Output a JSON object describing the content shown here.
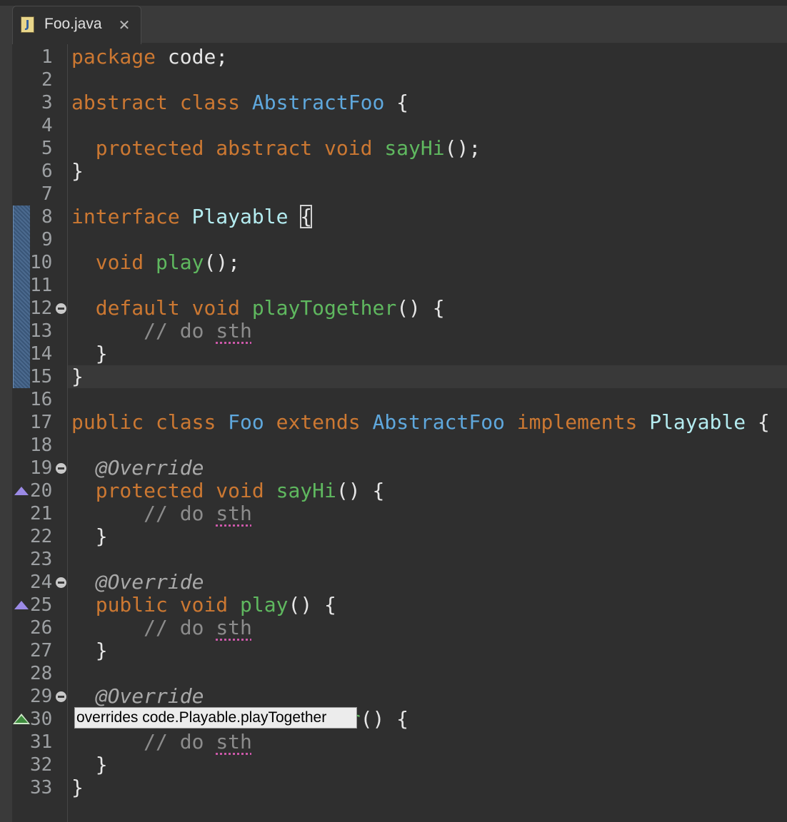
{
  "tab": {
    "title": "Foo.java",
    "icon": "java-file-icon",
    "close_icon": "close-icon"
  },
  "tooltip": "overrides code.Playable.playTogether",
  "lines": [
    {
      "n": "1",
      "tokens": [
        [
          "kw",
          "package"
        ],
        [
          "txt",
          " code;"
        ]
      ]
    },
    {
      "n": "2",
      "tokens": []
    },
    {
      "n": "3",
      "tokens": [
        [
          "kw",
          "abstract"
        ],
        [
          "txt",
          " "
        ],
        [
          "kw",
          "class"
        ],
        [
          "txt",
          " "
        ],
        [
          "cls",
          "AbstractFoo"
        ],
        [
          "txt",
          " {"
        ]
      ]
    },
    {
      "n": "4",
      "tokens": []
    },
    {
      "n": "5",
      "tokens": [
        [
          "txt",
          "  "
        ],
        [
          "kw",
          "protected"
        ],
        [
          "txt",
          " "
        ],
        [
          "kw",
          "abstract"
        ],
        [
          "txt",
          " "
        ],
        [
          "kw",
          "void"
        ],
        [
          "txt",
          " "
        ],
        [
          "mth",
          "sayHi"
        ],
        [
          "txt",
          "();"
        ]
      ]
    },
    {
      "n": "6",
      "tokens": [
        [
          "txt",
          "}"
        ]
      ]
    },
    {
      "n": "7",
      "tokens": []
    },
    {
      "n": "8",
      "tokens": [
        [
          "kw",
          "interface"
        ],
        [
          "txt",
          " "
        ],
        [
          "iface",
          "Playable"
        ],
        [
          "txt",
          " "
        ],
        [
          "txt-box",
          "{"
        ]
      ]
    },
    {
      "n": "9",
      "tokens": []
    },
    {
      "n": "10",
      "tokens": [
        [
          "txt",
          "  "
        ],
        [
          "kw",
          "void"
        ],
        [
          "txt",
          " "
        ],
        [
          "mth",
          "play"
        ],
        [
          "txt",
          "();"
        ]
      ]
    },
    {
      "n": "11",
      "tokens": []
    },
    {
      "n": "12",
      "tokens": [
        [
          "txt",
          "  "
        ],
        [
          "kw",
          "default"
        ],
        [
          "txt",
          " "
        ],
        [
          "kw",
          "void"
        ],
        [
          "txt",
          " "
        ],
        [
          "mth",
          "playTogether"
        ],
        [
          "txt",
          "() {"
        ]
      ],
      "marker": "fold"
    },
    {
      "n": "13",
      "tokens": [
        [
          "txt",
          "      "
        ],
        [
          "cmt",
          "// do "
        ],
        [
          "cmt-sth",
          "sth"
        ]
      ]
    },
    {
      "n": "14",
      "tokens": [
        [
          "txt",
          "  }"
        ]
      ]
    },
    {
      "n": "15",
      "tokens": [
        [
          "txt",
          "}"
        ]
      ]
    },
    {
      "n": "16",
      "tokens": []
    },
    {
      "n": "17",
      "tokens": [
        [
          "kw",
          "public"
        ],
        [
          "txt",
          " "
        ],
        [
          "kw",
          "class"
        ],
        [
          "txt",
          " "
        ],
        [
          "cls",
          "Foo"
        ],
        [
          "txt",
          " "
        ],
        [
          "kw",
          "extends"
        ],
        [
          "txt",
          " "
        ],
        [
          "cls",
          "AbstractFoo"
        ],
        [
          "txt",
          " "
        ],
        [
          "kw",
          "implements"
        ],
        [
          "txt",
          " "
        ],
        [
          "iface",
          "Playable"
        ],
        [
          "txt",
          " {"
        ]
      ]
    },
    {
      "n": "18",
      "tokens": []
    },
    {
      "n": "19",
      "tokens": [
        [
          "txt",
          "  "
        ],
        [
          "ann",
          "@Override"
        ]
      ],
      "marker": "fold"
    },
    {
      "n": "20",
      "tokens": [
        [
          "txt",
          "  "
        ],
        [
          "kw",
          "protected"
        ],
        [
          "txt",
          " "
        ],
        [
          "kw",
          "void"
        ],
        [
          "txt",
          " "
        ],
        [
          "mth",
          "sayHi"
        ],
        [
          "txt",
          "() {"
        ]
      ],
      "marker": "override"
    },
    {
      "n": "21",
      "tokens": [
        [
          "txt",
          "      "
        ],
        [
          "cmt",
          "// do "
        ],
        [
          "cmt-sth",
          "sth"
        ]
      ]
    },
    {
      "n": "22",
      "tokens": [
        [
          "txt",
          "  }"
        ]
      ]
    },
    {
      "n": "23",
      "tokens": []
    },
    {
      "n": "24",
      "tokens": [
        [
          "txt",
          "  "
        ],
        [
          "ann",
          "@Override"
        ]
      ],
      "marker": "fold"
    },
    {
      "n": "25",
      "tokens": [
        [
          "txt",
          "  "
        ],
        [
          "kw",
          "public"
        ],
        [
          "txt",
          " "
        ],
        [
          "kw",
          "void"
        ],
        [
          "txt",
          " "
        ],
        [
          "mth",
          "play"
        ],
        [
          "txt",
          "() {"
        ]
      ],
      "marker": "override"
    },
    {
      "n": "26",
      "tokens": [
        [
          "txt",
          "      "
        ],
        [
          "cmt",
          "// do "
        ],
        [
          "cmt-sth",
          "sth"
        ]
      ]
    },
    {
      "n": "27",
      "tokens": [
        [
          "txt",
          "  }"
        ]
      ]
    },
    {
      "n": "28",
      "tokens": []
    },
    {
      "n": "29",
      "tokens": [
        [
          "txt",
          "  "
        ],
        [
          "ann",
          "@Override"
        ]
      ],
      "marker": "fold"
    },
    {
      "n": "30",
      "tokens": [
        [
          "txt",
          "                      "
        ],
        [
          "mth",
          "er"
        ],
        [
          "txt",
          "() {"
        ]
      ],
      "marker": "implements"
    },
    {
      "n": "31",
      "tokens": [
        [
          "txt",
          "      "
        ],
        [
          "cmt",
          "// do "
        ],
        [
          "cmt-sth",
          "sth"
        ]
      ]
    },
    {
      "n": "32",
      "tokens": [
        [
          "txt",
          "  }"
        ]
      ]
    },
    {
      "n": "33",
      "tokens": [
        [
          "txt",
          "}"
        ]
      ]
    }
  ]
}
